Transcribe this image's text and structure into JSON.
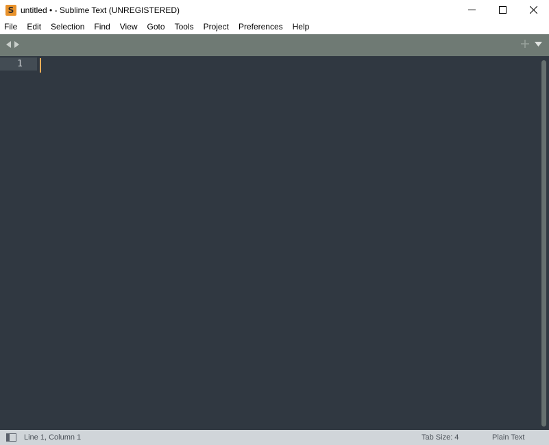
{
  "window": {
    "title": "untitled • - Sublime Text (UNREGISTERED)",
    "app_icon_letter": "S"
  },
  "menu": {
    "items": [
      "File",
      "Edit",
      "Selection",
      "Find",
      "View",
      "Goto",
      "Tools",
      "Project",
      "Preferences",
      "Help"
    ]
  },
  "editor": {
    "line_numbers": [
      "1"
    ],
    "content": ""
  },
  "status": {
    "position": "Line 1, Column 1",
    "tab_size": "Tab Size: 4",
    "syntax": "Plain Text"
  },
  "colors": {
    "editor_bg": "#303841",
    "tabbar_bg": "#6f7a74",
    "statusbar_bg": "#d0d5d9",
    "caret": "#f9ae58",
    "app_icon": "#e8922c"
  },
  "icons": {
    "app": "sublime-logo-icon",
    "minimize": "minimize-icon",
    "maximize": "maximize-icon",
    "close": "close-icon",
    "back": "arrow-left-icon",
    "forward": "arrow-right-icon",
    "new_tab": "plus-icon",
    "tab_list": "triangle-down-icon",
    "side_panel": "panel-toggle-icon"
  }
}
